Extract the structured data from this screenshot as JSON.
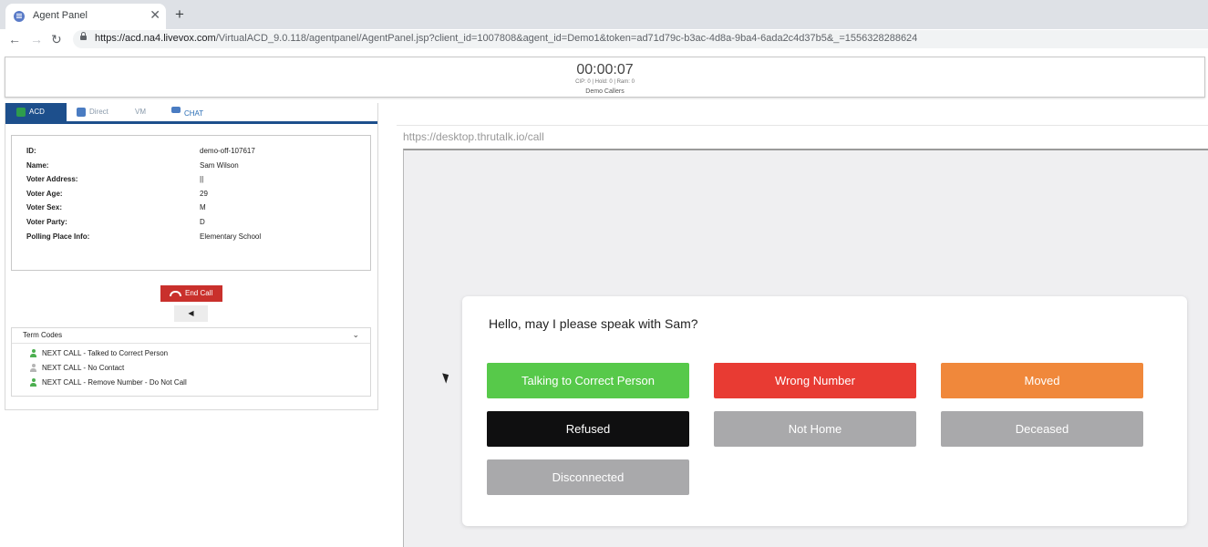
{
  "browser": {
    "tab_title": "Agent Panel",
    "tab_close": "✕",
    "new_tab": "+",
    "url_host": "https://acd.na4.livevox.com",
    "url_path": "/VirtualACD_9.0.118/agentpanel/AgentPanel.jsp?client_id=1007808&agent_id=Demo1&token=ad71d79c-b3ac-4d8a-9ba4-6ada2c4d37b5&_=1556328288624"
  },
  "status": {
    "timer": "00:00:07",
    "counts": "CIP: 0 | Hold: 0 | Ram: 0",
    "campaign": "Demo Callers"
  },
  "tabs": {
    "acd": "ACD",
    "direct": "Direct",
    "vm": "VM",
    "chat": "CHAT"
  },
  "info": [
    {
      "label": "ID:",
      "value": "demo-off-107617"
    },
    {
      "label": "Name:",
      "value": "Sam Wilson"
    },
    {
      "label": "Voter Address:",
      "value": "||"
    },
    {
      "label": "Voter Age:",
      "value": "29"
    },
    {
      "label": "Voter Sex:",
      "value": "M"
    },
    {
      "label": "Voter Party:",
      "value": "D"
    },
    {
      "label": "Polling Place Info:",
      "value": "Elementary School"
    }
  ],
  "controls": {
    "end_call": "End Call",
    "mute": "◀"
  },
  "term_codes": {
    "title": "Term Codes",
    "chevron": "⌄",
    "items": [
      {
        "label": "NEXT CALL - Talked to Correct Person",
        "color": "#4caf50"
      },
      {
        "label": "NEXT CALL - No Contact",
        "color": "#b5b5b5"
      },
      {
        "label": "NEXT CALL - Remove Number - Do Not Call",
        "color": "#4caf50"
      }
    ]
  },
  "embedded": {
    "url": "https://desktop.thrutalk.io/call",
    "prompt": "Hello, may I please speak with Sam?",
    "buttons": [
      {
        "label": "Talking to Correct Person",
        "color": "#57c94a"
      },
      {
        "label": "Wrong Number",
        "color": "#e83b33"
      },
      {
        "label": "Moved",
        "color": "#f0883b"
      },
      {
        "label": "Refused",
        "color": "#0f0f10"
      },
      {
        "label": "Not Home",
        "color": "#a9a9ab"
      },
      {
        "label": "Deceased",
        "color": "#a9a9ab"
      },
      {
        "label": "Disconnected",
        "color": "#a9a9ab"
      }
    ]
  }
}
